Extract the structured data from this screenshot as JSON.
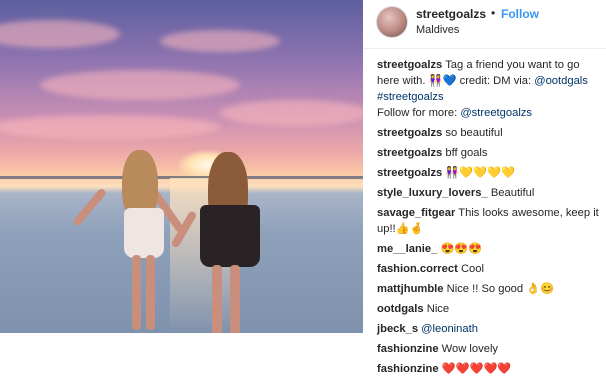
{
  "post": {
    "username": "streetgoalzs",
    "dot": "•",
    "follow_label": "Follow",
    "location": "Maldives"
  },
  "caption": {
    "username": "streetgoalzs",
    "text1": "Tag a friend you want to go here with. ",
    "emoji1": "👭💙",
    "text2": " credit: DM via: ",
    "mention1": "@ootdgals",
    "hashtag": "#streetgoalzs",
    "text3": "Follow for more: ",
    "mention2": "@streetgoalzs"
  },
  "comments": [
    {
      "user": "streetgoalzs",
      "text": "so beautiful"
    },
    {
      "user": "streetgoalzs",
      "text": "bff goals"
    },
    {
      "user": "streetgoalzs",
      "text": "👭💛💛💛💛"
    },
    {
      "user": "style_luxury_lovers_",
      "text": "Beautiful"
    },
    {
      "user": "savage_fitgear",
      "text": "This looks awesome, keep it up!!👍🤞"
    },
    {
      "user": "me__lanie_",
      "text": "😍😍😍"
    },
    {
      "user": "fashion.correct",
      "text": "Cool"
    },
    {
      "user": "mattjhumble",
      "text": "Nice !! So good 👌😊"
    },
    {
      "user": "ootdgals",
      "text": "Nice"
    },
    {
      "user": "jbeck_s",
      "text": "@leoninath"
    },
    {
      "user": "fashionzine",
      "text": "Wow lovely"
    }
  ],
  "partial_comment": {
    "user": "fashionzine",
    "text": "❤️❤️❤️❤️❤️"
  }
}
